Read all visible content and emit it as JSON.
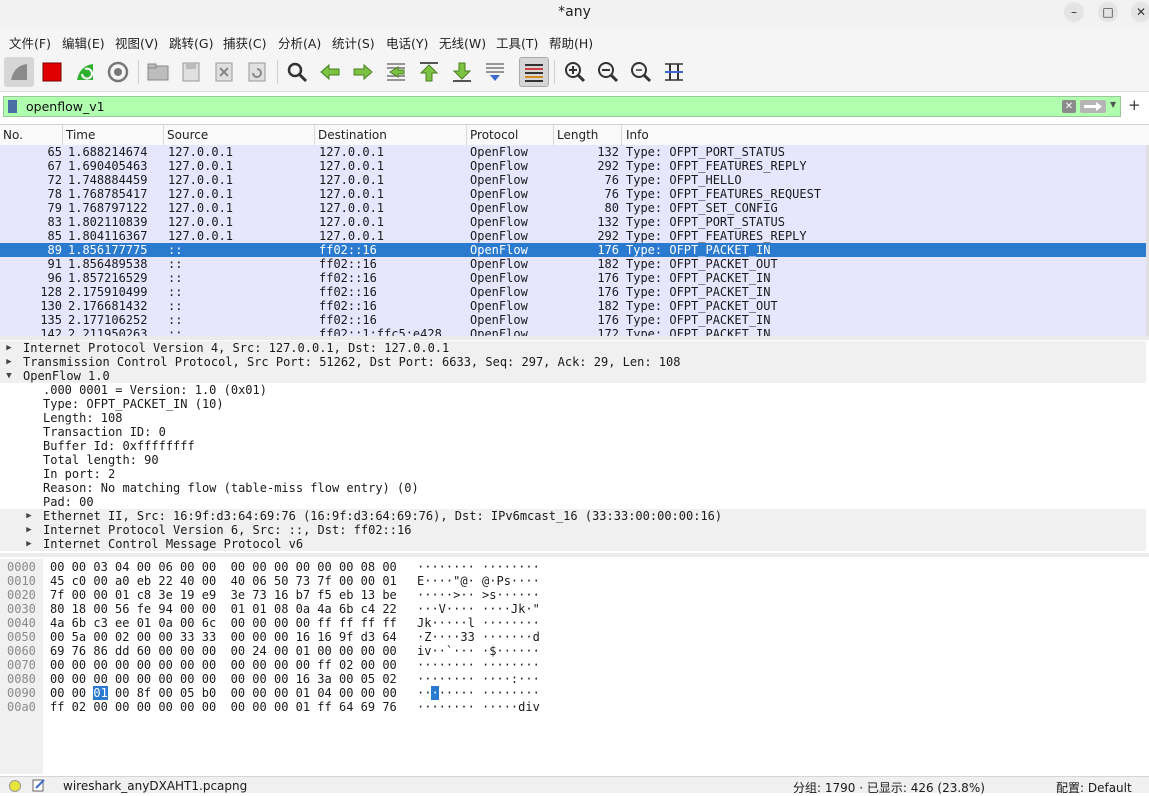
{
  "window": {
    "title": "*any",
    "min_label": "–",
    "max_label": "□",
    "close_label": "✕"
  },
  "menu": [
    "文件(F)",
    "编辑(E)",
    "视图(V)",
    "跳转(G)",
    "捕获(C)",
    "分析(A)",
    "统计(S)",
    "电话(Y)",
    "无线(W)",
    "工具(T)",
    "帮助(H)"
  ],
  "filter": {
    "value": "openflow_v1",
    "add_label": "+"
  },
  "columns": [
    "No.",
    "Time",
    "Source",
    "Destination",
    "Protocol",
    "Length",
    "Info"
  ],
  "packets": [
    {
      "no": "65",
      "time": "1.688214674",
      "src": "127.0.0.1",
      "dst": "127.0.0.1",
      "proto": "OpenFlow",
      "len": "132",
      "info": "Type: OFPT_PORT_STATUS"
    },
    {
      "no": "67",
      "time": "1.690405463",
      "src": "127.0.0.1",
      "dst": "127.0.0.1",
      "proto": "OpenFlow",
      "len": "292",
      "info": "Type: OFPT_FEATURES_REPLY"
    },
    {
      "no": "72",
      "time": "1.748884459",
      "src": "127.0.0.1",
      "dst": "127.0.0.1",
      "proto": "OpenFlow",
      "len": "76",
      "info": "Type: OFPT_HELLO"
    },
    {
      "no": "78",
      "time": "1.768785417",
      "src": "127.0.0.1",
      "dst": "127.0.0.1",
      "proto": "OpenFlow",
      "len": "76",
      "info": "Type: OFPT_FEATURES_REQUEST"
    },
    {
      "no": "79",
      "time": "1.768797122",
      "src": "127.0.0.1",
      "dst": "127.0.0.1",
      "proto": "OpenFlow",
      "len": "80",
      "info": "Type: OFPT_SET_CONFIG"
    },
    {
      "no": "83",
      "time": "1.802110839",
      "src": "127.0.0.1",
      "dst": "127.0.0.1",
      "proto": "OpenFlow",
      "len": "132",
      "info": "Type: OFPT_PORT_STATUS"
    },
    {
      "no": "85",
      "time": "1.804116367",
      "src": "127.0.0.1",
      "dst": "127.0.0.1",
      "proto": "OpenFlow",
      "len": "292",
      "info": "Type: OFPT_FEATURES_REPLY"
    },
    {
      "no": "89",
      "time": "1.856177775",
      "src": "::",
      "dst": "ff02::16",
      "proto": "OpenFlow",
      "len": "176",
      "info": "Type: OFPT_PACKET_IN",
      "selected": true
    },
    {
      "no": "91",
      "time": "1.856489538",
      "src": "::",
      "dst": "ff02::16",
      "proto": "OpenFlow",
      "len": "182",
      "info": "Type: OFPT_PACKET_OUT"
    },
    {
      "no": "96",
      "time": "1.857216529",
      "src": "::",
      "dst": "ff02::16",
      "proto": "OpenFlow",
      "len": "176",
      "info": "Type: OFPT_PACKET_IN"
    },
    {
      "no": "128",
      "time": "2.175910499",
      "src": "::",
      "dst": "ff02::16",
      "proto": "OpenFlow",
      "len": "176",
      "info": "Type: OFPT_PACKET_IN"
    },
    {
      "no": "130",
      "time": "2.176681432",
      "src": "::",
      "dst": "ff02::16",
      "proto": "OpenFlow",
      "len": "182",
      "info": "Type: OFPT_PACKET_OUT"
    },
    {
      "no": "135",
      "time": "2.177106252",
      "src": "::",
      "dst": "ff02::16",
      "proto": "OpenFlow",
      "len": "176",
      "info": "Type: OFPT_PACKET_IN"
    },
    {
      "no": "142",
      "time": "2.211950263",
      "src": "::",
      "dst": "ff02::1:ffc5:e428",
      "proto": "OpenFlow",
      "len": "172",
      "info": "Type: OFPT_PACKET_IN"
    }
  ],
  "details": [
    {
      "level": 0,
      "state": "collapsed",
      "text": "Internet Protocol Version 4, Src: 127.0.0.1, Dst: 127.0.0.1"
    },
    {
      "level": 0,
      "state": "collapsed",
      "text": "Transmission Control Protocol, Src Port: 51262, Dst Port: 6633, Seq: 297, Ack: 29, Len: 108"
    },
    {
      "level": 0,
      "state": "expanded",
      "text": "OpenFlow 1.0"
    },
    {
      "level": 1,
      "state": "leaf",
      "text": ".000 0001 = Version: 1.0 (0x01)"
    },
    {
      "level": 1,
      "state": "leaf",
      "text": "Type: OFPT_PACKET_IN (10)"
    },
    {
      "level": 1,
      "state": "leaf",
      "text": "Length: 108"
    },
    {
      "level": 1,
      "state": "leaf",
      "text": "Transaction ID: 0"
    },
    {
      "level": 1,
      "state": "leaf",
      "text": "Buffer Id: 0xffffffff"
    },
    {
      "level": 1,
      "state": "leaf",
      "text": "Total length: 90"
    },
    {
      "level": 1,
      "state": "leaf",
      "text": "In port: 2"
    },
    {
      "level": 1,
      "state": "leaf",
      "text": "Reason: No matching flow (table-miss flow entry) (0)"
    },
    {
      "level": 1,
      "state": "leaf",
      "text": "Pad: 00"
    },
    {
      "level": 1,
      "state": "collapsed",
      "text": "Ethernet II, Src: 16:9f:d3:64:69:76 (16:9f:d3:64:69:76), Dst: IPv6mcast_16 (33:33:00:00:00:16)"
    },
    {
      "level": 1,
      "state": "collapsed",
      "text": "Internet Protocol Version 6, Src: ::, Dst: ff02::16"
    },
    {
      "level": 1,
      "state": "collapsed",
      "text": "Internet Control Message Protocol v6"
    }
  ],
  "bytes": [
    {
      "off": "0000",
      "hex": "00 00 03 04 00 06 00 00  00 00 00 00 00 00 08 00",
      "ascii": "········ ········"
    },
    {
      "off": "0010",
      "hex": "45 c0 00 a0 eb 22 40 00  40 06 50 73 7f 00 00 01",
      "ascii": "E····\"@· @·Ps····"
    },
    {
      "off": "0020",
      "hex": "7f 00 00 01 c8 3e 19 e9  3e 73 16 b7 f5 eb 13 be",
      "ascii": "·····>·· >s······"
    },
    {
      "off": "0030",
      "hex": "80 18 00 56 fe 94 00 00  01 01 08 0a 4a 6b c4 22",
      "ascii": "···V···· ····Jk·\""
    },
    {
      "off": "0040",
      "hex": "4a 6b c3 ee 01 0a 00 6c  00 00 00 00 ff ff ff ff",
      "ascii": "Jk·····l ········"
    },
    {
      "off": "0050",
      "hex": "00 5a 00 02 00 00 33 33  00 00 00 16 16 9f d3 64",
      "ascii": "·Z····33 ·······d"
    },
    {
      "off": "0060",
      "hex": "69 76 86 dd 60 00 00 00  00 24 00 01 00 00 00 00",
      "ascii": "iv··`··· ·$······"
    },
    {
      "off": "0070",
      "hex": "00 00 00 00 00 00 00 00  00 00 00 00 ff 02 00 00",
      "ascii": "········ ········"
    },
    {
      "off": "0080",
      "hex": "00 00 00 00 00 00 00 00  00 00 00 16 3a 00 05 02",
      "ascii": "········ ····:···"
    },
    {
      "off": "0090",
      "hex_pre": "00 00 ",
      "hex_hl": "01",
      "hex_post": " 00 8f 00 05 b0  00 00 00 01 04 00 00 00",
      "ascii_pre": "··",
      "ascii_hl": "·",
      "ascii_post": "····· ········"
    },
    {
      "off": "00a0",
      "hex": "ff 02 00 00 00 00 00 00  00 00 00 01 ff 64 69 76",
      "ascii": "········ ·····div"
    }
  ],
  "status": {
    "file": "wireshark_anyDXAHT1.pcapng",
    "counts": "分组: 1790 · 已显示: 426 (23.8%)",
    "profile": "配置: Default"
  },
  "colors": {
    "selected": "#2a7bd0",
    "row_bg": "#e7e6ff",
    "filter_ok": "#afffaf"
  }
}
